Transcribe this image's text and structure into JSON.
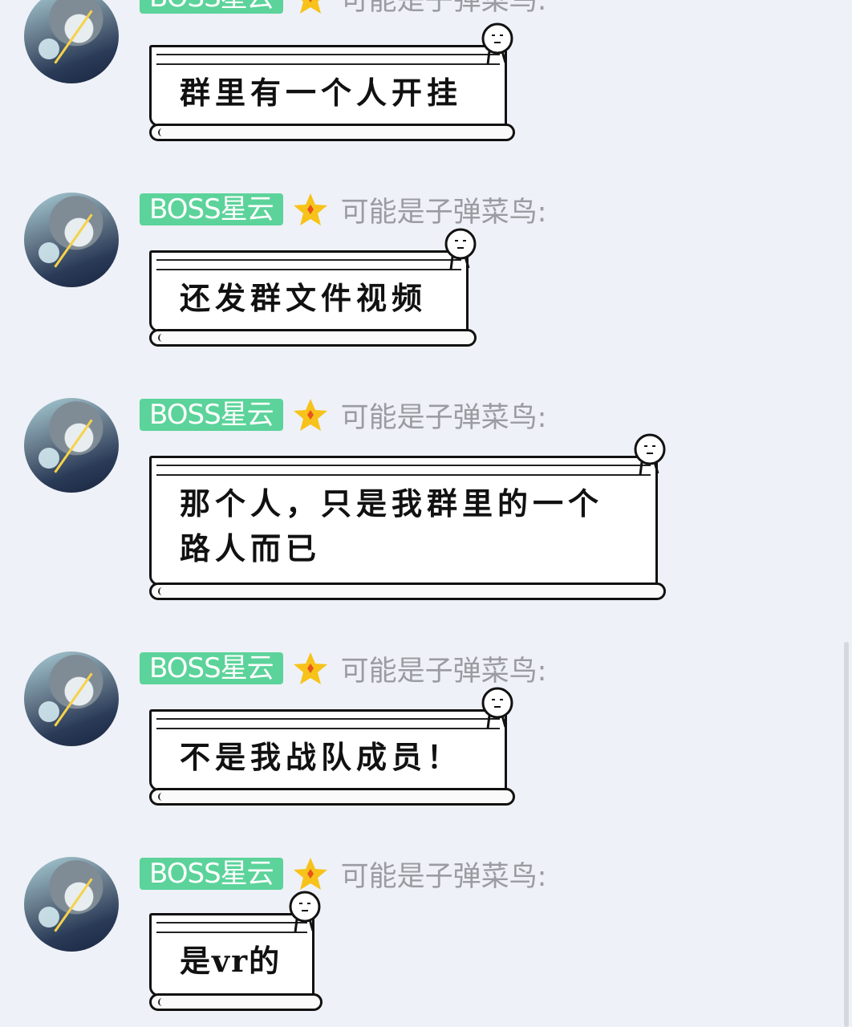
{
  "messages": [
    {
      "badge": "BOSS星云",
      "nickname": "可能是子弹菜鸟:",
      "text": "群里有一个人开挂"
    },
    {
      "badge": "BOSS星云",
      "nickname": "可能是子弹菜鸟:",
      "text": "还发群文件视频"
    },
    {
      "badge": "BOSS星云",
      "nickname": "可能是子弹菜鸟:",
      "text": "那个人，只是我群里的一个路人而已"
    },
    {
      "badge": "BOSS星云",
      "nickname": "可能是子弹菜鸟:",
      "text": "不是我战队成员！"
    },
    {
      "badge": "BOSS星云",
      "nickname": "可能是子弹菜鸟:",
      "text": "是vr的"
    }
  ],
  "colors": {
    "badge_bg": "#5cd39a",
    "star": "#f7c21a",
    "nickname": "#9a9ca1",
    "background": "#eef1f7"
  },
  "icons": {
    "rank": "star-icon",
    "bubble_decoration": "stick-figure-icon"
  }
}
